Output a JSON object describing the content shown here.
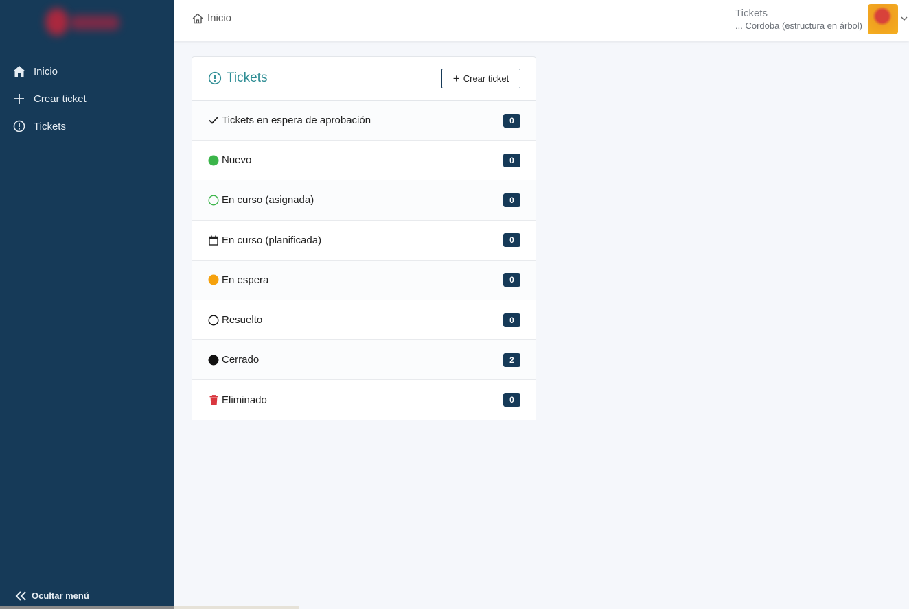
{
  "sidebar": {
    "items": [
      {
        "label": "Inicio",
        "icon": "home-icon"
      },
      {
        "label": "Crear ticket",
        "icon": "plus-icon"
      },
      {
        "label": "Tickets",
        "icon": "exclamation-circle-icon"
      }
    ],
    "hide_menu": "Ocultar menú"
  },
  "header": {
    "breadcrumb": "Inicio",
    "user_title": "Tickets",
    "user_sub": "... Cordoba (estructura en árbol)"
  },
  "card": {
    "title": "Tickets",
    "create_button": "Crear ticket",
    "rows": [
      {
        "label": "Tickets en espera de aprobación",
        "count": "0",
        "icon": "check-icon"
      },
      {
        "label": "Nuevo",
        "count": "0",
        "icon": "green-filled-circle-icon"
      },
      {
        "label": "En curso (asignada)",
        "count": "0",
        "icon": "green-outline-circle-icon"
      },
      {
        "label": "En curso (planificada)",
        "count": "0",
        "icon": "calendar-icon"
      },
      {
        "label": "En espera",
        "count": "0",
        "icon": "orange-filled-circle-icon"
      },
      {
        "label": "Resuelto",
        "count": "0",
        "icon": "black-outline-circle-icon"
      },
      {
        "label": "Cerrado",
        "count": "2",
        "icon": "black-filled-circle-icon"
      },
      {
        "label": "Eliminado",
        "count": "0",
        "icon": "trash-icon"
      }
    ]
  },
  "colors": {
    "sidebar_bg": "#163a58",
    "accent_teal": "#2e8d94",
    "badge_bg": "#163a58",
    "status_new": "#3bb54a",
    "status_waiting": "#f5a10d",
    "status_deleted": "#d9363e"
  }
}
